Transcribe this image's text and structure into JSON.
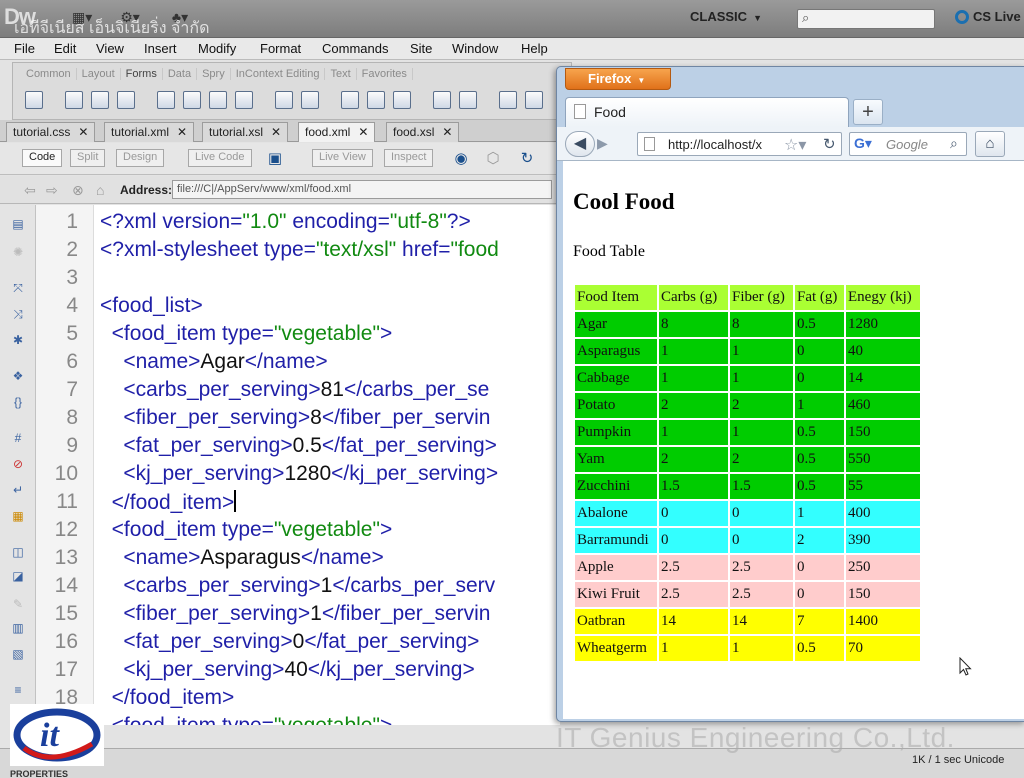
{
  "dw": {
    "logo": "Dw",
    "title_overlay": "เอทีจีเนียส เอ็นจิเนียริ่ง จำกัด",
    "workspace": "CLASSIC",
    "cs_live": "CS Live",
    "menu": [
      "File",
      "Edit",
      "View",
      "Insert",
      "Modify",
      "Format",
      "Commands",
      "Site",
      "Window",
      "Help"
    ],
    "insert_tabs": [
      "Common",
      "Layout",
      "Forms",
      "Data",
      "Spry",
      "InContext Editing",
      "Text",
      "Favorites"
    ],
    "doc_tabs": [
      "tutorial.css",
      "tutorial.xml",
      "tutorial.xsl",
      "food.xml",
      "food.xsl"
    ],
    "active_doc": "food.xml",
    "view_buttons": [
      "Code",
      "Split",
      "Design",
      "Live Code",
      "Live View",
      "Inspect"
    ],
    "address_label": "Address:",
    "address_value": "file:///C|/AppServ/www/xml/food.xml",
    "code_lines": [
      {
        "n": "1",
        "pre": "<?xml version=",
        "s1": "\"1.0\"",
        "mid": " encoding=",
        "s2": "\"utf-8\"",
        "post": "?>",
        "txt": ""
      },
      {
        "n": "2",
        "pre": "<?xml-stylesheet type=",
        "s1": "\"text/xsl\"",
        "mid": " href=",
        "s2": "\"food",
        "post": "",
        "txt": ""
      },
      {
        "n": "3",
        "pre": "",
        "s1": "",
        "mid": "",
        "s2": "",
        "post": "",
        "txt": ""
      },
      {
        "n": "4",
        "pre": "<food_list>",
        "s1": "",
        "mid": "",
        "s2": "",
        "post": "",
        "txt": ""
      },
      {
        "n": "5",
        "pre": "  <food_item type=",
        "s1": "\"vegetable\"",
        "mid": ">",
        "s2": "",
        "post": "",
        "txt": ""
      },
      {
        "n": "6",
        "pre": "    <name>",
        "s1": "",
        "mid": "",
        "s2": "",
        "post": "</name>",
        "txt": "Agar"
      },
      {
        "n": "7",
        "pre": "    <carbs_per_serving>",
        "s1": "",
        "mid": "",
        "s2": "",
        "post": "</carbs_per_se",
        "txt": "81"
      },
      {
        "n": "8",
        "pre": "    <fiber_per_serving>",
        "s1": "",
        "mid": "",
        "s2": "",
        "post": "</fiber_per_servin",
        "txt": "8"
      },
      {
        "n": "9",
        "pre": "    <fat_per_serving>",
        "s1": "",
        "mid": "",
        "s2": "",
        "post": "</fat_per_serving>",
        "txt": "0.5"
      },
      {
        "n": "10",
        "pre": "    <kj_per_serving>",
        "s1": "",
        "mid": "",
        "s2": "",
        "post": "</kj_per_serving>",
        "txt": "1280"
      },
      {
        "n": "11",
        "pre": "  </food_item>",
        "s1": "",
        "mid": "",
        "s2": "",
        "post": "",
        "txt": ""
      },
      {
        "n": "12",
        "pre": "  <food_item type=",
        "s1": "\"vegetable\"",
        "mid": ">",
        "s2": "",
        "post": "",
        "txt": ""
      },
      {
        "n": "13",
        "pre": "    <name>",
        "s1": "",
        "mid": "",
        "s2": "",
        "post": "</name>",
        "txt": "Asparagus"
      },
      {
        "n": "14",
        "pre": "    <carbs_per_serving>",
        "s1": "",
        "mid": "",
        "s2": "",
        "post": "</carbs_per_serv",
        "txt": "1"
      },
      {
        "n": "15",
        "pre": "    <fiber_per_serving>",
        "s1": "",
        "mid": "",
        "s2": "",
        "post": "</fiber_per_servin",
        "txt": "1"
      },
      {
        "n": "16",
        "pre": "    <fat_per_serving>",
        "s1": "",
        "mid": "",
        "s2": "",
        "post": "</fat_per_serving>",
        "txt": "0"
      },
      {
        "n": "17",
        "pre": "    <kj_per_serving>",
        "s1": "",
        "mid": "",
        "s2": "",
        "post": "</kj_per_serving>",
        "txt": "40"
      },
      {
        "n": "18",
        "pre": "  </food_item>",
        "s1": "",
        "mid": "",
        "s2": "",
        "post": "",
        "txt": ""
      },
      {
        "n": "",
        "pre": "  <food_item type=",
        "s1": "\"vegetable\"",
        "mid": ">",
        "s2": "",
        "post": "",
        "txt": ""
      }
    ],
    "status_info": "1K / 1 sec  Unicode",
    "props_label": "PROPERTIES"
  },
  "firefox": {
    "menu_button": "Firefox",
    "tab_title": "Food",
    "url": "http://localhost/x",
    "search_placeholder": "Google",
    "page_heading": "Cool Food",
    "page_subheading": "Food Table",
    "table_headers": [
      "Food Item",
      "Carbs (g)",
      "Fiber (g)",
      "Fat (g)",
      "Enegy (kj)"
    ],
    "table_rows": [
      {
        "cells": [
          "Agar",
          "8",
          "8",
          "0.5",
          "1280"
        ],
        "color": "#00cc00"
      },
      {
        "cells": [
          "Asparagus",
          "1",
          "1",
          "0",
          "40"
        ],
        "color": "#00cc00"
      },
      {
        "cells": [
          "Cabbage",
          "1",
          "1",
          "0",
          "14"
        ],
        "color": "#00cc00"
      },
      {
        "cells": [
          "Potato",
          "2",
          "2",
          "1",
          "460"
        ],
        "color": "#00cc00"
      },
      {
        "cells": [
          "Pumpkin",
          "1",
          "1",
          "0.5",
          "150"
        ],
        "color": "#00cc00"
      },
      {
        "cells": [
          "Yam",
          "2",
          "2",
          "0.5",
          "550"
        ],
        "color": "#00cc00"
      },
      {
        "cells": [
          "Zucchini",
          "1.5",
          "1.5",
          "0.5",
          "55"
        ],
        "color": "#00cc00"
      },
      {
        "cells": [
          "Abalone",
          "0",
          "0",
          "1",
          "400"
        ],
        "color": "#33ffff"
      },
      {
        "cells": [
          "Barramundi",
          "0",
          "0",
          "2",
          "390"
        ],
        "color": "#33ffff"
      },
      {
        "cells": [
          "Apple",
          "2.5",
          "2.5",
          "0",
          "250"
        ],
        "color": "#ffcccc"
      },
      {
        "cells": [
          "Kiwi Fruit",
          "2.5",
          "2.5",
          "0",
          "150"
        ],
        "color": "#ffcccc"
      },
      {
        "cells": [
          "Oatbran",
          "14",
          "14",
          "7",
          "1400"
        ],
        "color": "#ffff00"
      },
      {
        "cells": [
          "Wheatgerm",
          "1",
          "1",
          "0.5",
          "70"
        ],
        "color": "#ffff00"
      }
    ],
    "header_color": "#aaff33"
  },
  "watermark": {
    "company": "IT Genius Engineering Co.,Ltd.",
    "logo_text": "it",
    "logo_color": "#1a3f9c",
    "logo_accent": "#d11a1a"
  }
}
